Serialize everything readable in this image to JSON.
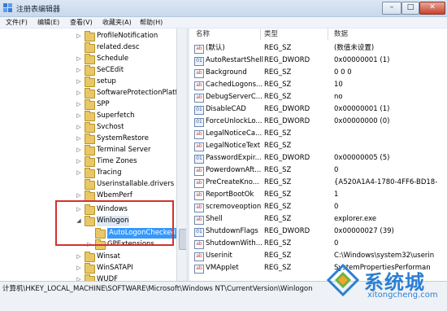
{
  "window": {
    "title": "注册表编辑器",
    "controls": {
      "minimize": "–",
      "maximize": "□",
      "close": "✕"
    }
  },
  "menu": [
    "文件(F)",
    "编辑(E)",
    "查看(V)",
    "收藏夹(A)",
    "帮助(H)"
  ],
  "tree": {
    "items": [
      {
        "label": "ProfileNotification"
      },
      {
        "label": "related.desc"
      },
      {
        "label": "Schedule"
      },
      {
        "label": "SeCEdit"
      },
      {
        "label": "setup"
      },
      {
        "label": "SoftwareProtectionPlatfo"
      },
      {
        "label": "SPP"
      },
      {
        "label": "Superfetch"
      },
      {
        "label": "Svchost"
      },
      {
        "label": "SystemRestore"
      },
      {
        "label": "Terminal Server"
      },
      {
        "label": "Time Zones"
      },
      {
        "label": "Tracing"
      },
      {
        "label": "Userinstallable.drivers"
      },
      {
        "label": "WbemPerf"
      },
      {
        "label": "Windows"
      },
      {
        "label": "Winlogon"
      },
      {
        "label": "AutoLogonChecked"
      },
      {
        "label": "GPExtensions"
      },
      {
        "label": "Winsat"
      },
      {
        "label": "WinSATAPI"
      },
      {
        "label": "WUDF"
      }
    ]
  },
  "columns": {
    "name": "名称",
    "type": "类型",
    "data": "数据"
  },
  "values": [
    {
      "name": "(默认)",
      "type": "REG_SZ",
      "data": "(数值未设置)",
      "icon": "string-value-icon"
    },
    {
      "name": "AutoRestartShell",
      "type": "REG_DWORD",
      "data": "0x00000001 (1)",
      "icon": "dword-value-icon"
    },
    {
      "name": "Background",
      "type": "REG_SZ",
      "data": "0 0 0",
      "icon": "string-value-icon"
    },
    {
      "name": "CachedLogons...",
      "type": "REG_SZ",
      "data": "10",
      "icon": "string-value-icon"
    },
    {
      "name": "DebugServerC...",
      "type": "REG_SZ",
      "data": "no",
      "icon": "string-value-icon"
    },
    {
      "name": "DisableCAD",
      "type": "REG_DWORD",
      "data": "0x00000001 (1)",
      "icon": "dword-value-icon"
    },
    {
      "name": "ForceUnlockLo...",
      "type": "REG_DWORD",
      "data": "0x00000000 (0)",
      "icon": "dword-value-icon"
    },
    {
      "name": "LegalNoticeCa...",
      "type": "REG_SZ",
      "data": "",
      "icon": "string-value-icon"
    },
    {
      "name": "LegalNoticeText",
      "type": "REG_SZ",
      "data": "",
      "icon": "string-value-icon"
    },
    {
      "name": "PasswordExpir...",
      "type": "REG_DWORD",
      "data": "0x00000005 (5)",
      "icon": "dword-value-icon"
    },
    {
      "name": "PowerdownAft...",
      "type": "REG_SZ",
      "data": "0",
      "icon": "string-value-icon"
    },
    {
      "name": "PreCreateKno...",
      "type": "REG_SZ",
      "data": "{A520A1A4-1780-4FF6-BD18-",
      "icon": "string-value-icon"
    },
    {
      "name": "ReportBootOk",
      "type": "REG_SZ",
      "data": "1",
      "icon": "string-value-icon"
    },
    {
      "name": "scremoveoption",
      "type": "REG_SZ",
      "data": "0",
      "icon": "string-value-icon"
    },
    {
      "name": "Shell",
      "type": "REG_SZ",
      "data": "explorer.exe",
      "icon": "string-value-icon"
    },
    {
      "name": "ShutdownFlags",
      "type": "REG_DWORD",
      "data": "0x00000027 (39)",
      "icon": "dword-value-icon"
    },
    {
      "name": "ShutdownWith...",
      "type": "REG_SZ",
      "data": "0",
      "icon": "string-value-icon"
    },
    {
      "name": "Userinit",
      "type": "REG_SZ",
      "data": "C:\\Windows\\system32\\userin",
      "icon": "string-value-icon"
    },
    {
      "name": "VMApplet",
      "type": "REG_SZ",
      "data": "SystemPropertiesPerforman",
      "icon": "string-value-icon"
    }
  ],
  "status": {
    "path": "计算机\\HKEY_LOCAL_MACHINE\\SOFTWARE\\Microsoft\\Windows NT\\CurrentVersion\\Winlogon"
  },
  "watermark": {
    "name": "系统城",
    "url": "xitongcheng.com"
  }
}
